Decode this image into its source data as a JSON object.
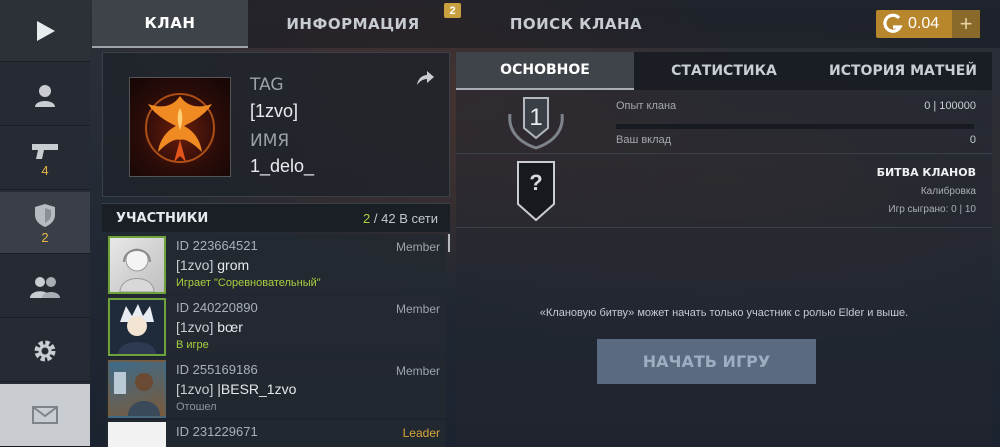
{
  "nav": {
    "items": [
      {
        "name": "play",
        "badge": ""
      },
      {
        "name": "profile",
        "badge": ""
      },
      {
        "name": "weapons",
        "badge": "4"
      },
      {
        "name": "clan",
        "badge": "2"
      },
      {
        "name": "friends",
        "badge": ""
      },
      {
        "name": "settings",
        "badge": ""
      },
      {
        "name": "mail",
        "badge": ""
      }
    ]
  },
  "tabs": [
    {
      "label": "КЛАН",
      "active": true
    },
    {
      "label": "ИНФОРМАЦИЯ",
      "badge": "2"
    },
    {
      "label": "ПОИСК КЛАНА"
    }
  ],
  "currency": {
    "amount": "0.04",
    "plus": "+"
  },
  "clan": {
    "tag_label": "TAG",
    "tag_value": "[1zvo]",
    "name_label": "ИМЯ",
    "name_value": "1_delo_"
  },
  "members": {
    "title": "УЧАСТНИКИ",
    "online": "2",
    "total_text": "/ 42 В сети",
    "list": [
      {
        "id": "ID 223664521",
        "tag": "[1zvo]",
        "name": "grom",
        "status": "Играет \"Соревновательный\"",
        "role": "Member",
        "status_color": "#a8cf3f"
      },
      {
        "id": "ID 240220890",
        "tag": "[1zvo]",
        "name": "bœr",
        "status": "В игре",
        "role": "Member",
        "status_color": "#a8cf3f"
      },
      {
        "id": "ID 255169186",
        "tag": "[1zvo]",
        "name": "|BESR_1zvo",
        "status": "Отошел",
        "role": "Member",
        "status_color": "#8f959c"
      },
      {
        "id": "ID 231229671",
        "tag": "",
        "name": "",
        "status": "",
        "role": "Leader",
        "status_color": "#8f959c"
      }
    ]
  },
  "subtabs": [
    {
      "label": "ОСНОВНОЕ",
      "active": true
    },
    {
      "label": "СТАТИСТИКА"
    },
    {
      "label": "ИСТОРИЯ МАТЧЕЙ"
    }
  ],
  "overview": {
    "rank": "1",
    "xp_label": "Опыт клана",
    "xp_value": "0 | 100000",
    "xp_progress": 0,
    "contrib_label": "Ваш вклад",
    "contrib_value": "0",
    "battle_rank": "?",
    "battle_title": "БИТВА КЛАНОВ",
    "battle_status": "Калибровка",
    "battle_games": "Игр сыграно: 0 | 10",
    "notice": "«Клановую битву» может начать только участник с ролью Elder и выше.",
    "start_button": "НАЧАТЬ ИГРУ"
  },
  "colors": {
    "accent_gold": "#c9a040",
    "online_green": "#a8cf3f",
    "leader": "#d8a63b"
  }
}
